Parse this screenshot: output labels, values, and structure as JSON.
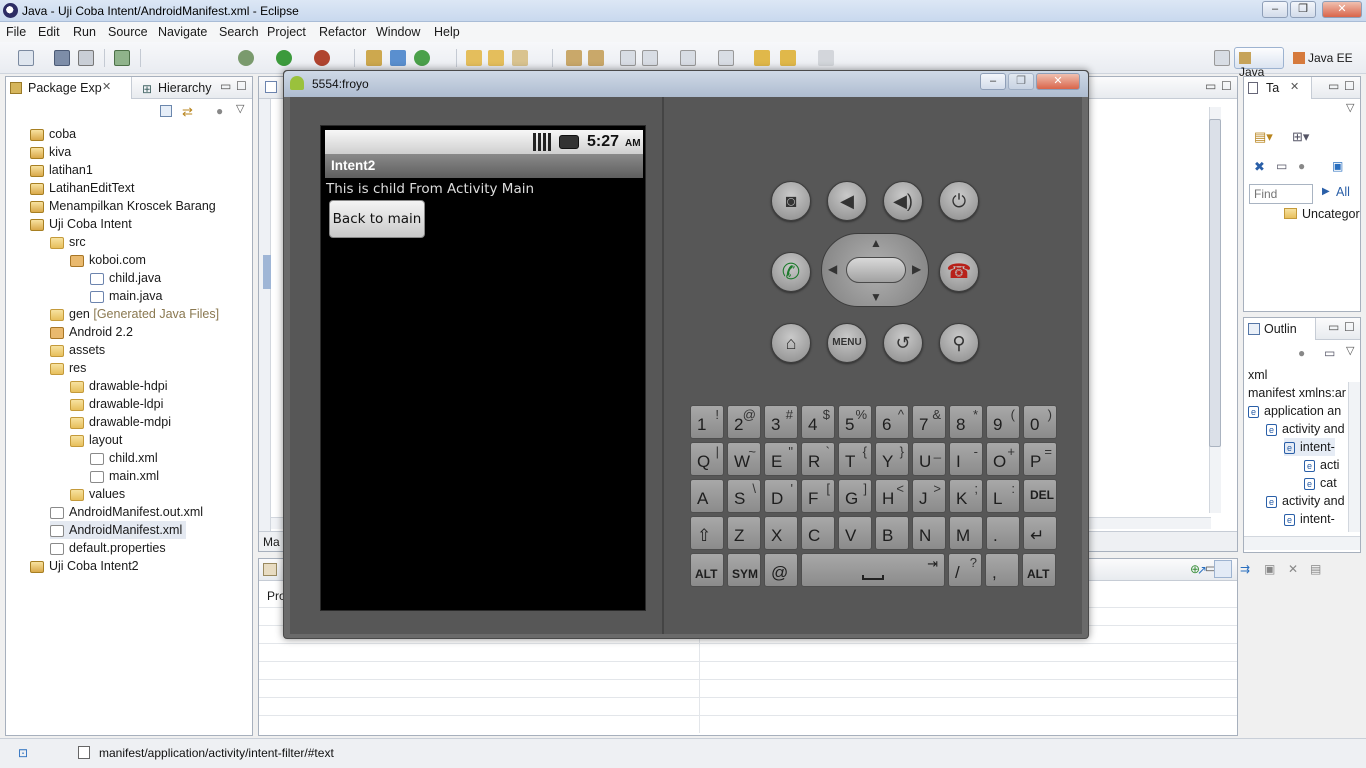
{
  "window": {
    "title": "Java - Uji Coba Intent/AndroidManifest.xml - Eclipse"
  },
  "menu": [
    "File",
    "Edit",
    "Run",
    "Source",
    "Navigate",
    "Search",
    "Project",
    "Refactor",
    "Window",
    "Help"
  ],
  "perspectives": {
    "java": "Java",
    "javaee": "Java EE"
  },
  "package_explorer": {
    "tabs": [
      "Package Exp",
      "Hierarchy"
    ],
    "items": [
      {
        "label": "coba",
        "icon": "project-icon"
      },
      {
        "label": "kiva",
        "icon": "project-icon"
      },
      {
        "label": "latihan1",
        "icon": "project-icon"
      },
      {
        "label": "LatihanEditText",
        "icon": "project-icon"
      },
      {
        "label": "Menampilkan Kroscek Barang",
        "icon": "project-icon"
      },
      {
        "label": "Uji Coba Intent",
        "icon": "project-icon"
      },
      {
        "label": "src",
        "icon": "folder-icon"
      },
      {
        "label": "koboi.com",
        "icon": "package-icon"
      },
      {
        "label": "child.java",
        "icon": "java-file-icon"
      },
      {
        "label": "main.java",
        "icon": "java-file-icon"
      },
      {
        "label": "gen",
        "suffix": "[Generated Java Files]",
        "icon": "folder-icon"
      },
      {
        "label": "Android 2.2",
        "icon": "library-icon"
      },
      {
        "label": "assets",
        "icon": "folder-icon"
      },
      {
        "label": "res",
        "icon": "folder-icon"
      },
      {
        "label": "drawable-hdpi",
        "icon": "folder-icon"
      },
      {
        "label": "drawable-ldpi",
        "icon": "folder-icon"
      },
      {
        "label": "drawable-mdpi",
        "icon": "folder-icon"
      },
      {
        "label": "layout",
        "icon": "folder-icon"
      },
      {
        "label": "child.xml",
        "icon": "xml-file-icon"
      },
      {
        "label": "main.xml",
        "icon": "xml-file-icon"
      },
      {
        "label": "values",
        "icon": "folder-icon"
      },
      {
        "label": "AndroidManifest.out.xml",
        "icon": "xml-file-icon"
      },
      {
        "label": "AndroidManifest.xml",
        "icon": "xml-file-icon"
      },
      {
        "label": "default.properties",
        "icon": "file-icon"
      },
      {
        "label": "Uji Coba Intent2",
        "icon": "project-icon"
      }
    ]
  },
  "editor": {
    "bottom_tab_fragment": "Ma",
    "problems_fragment": "Pro"
  },
  "task_view": {
    "tab": "Ta",
    "find_placeholder": "Find",
    "all_label": "All",
    "uncategorized": "Uncategor"
  },
  "outline": {
    "tab": "Outlin",
    "items": [
      "xml",
      "manifest xmlns:ar",
      "application an",
      "activity and",
      "intent-",
      "acti",
      "cat",
      "activity and",
      "intent-"
    ]
  },
  "emulator": {
    "title": "5554:froyo",
    "status_time": "5:27",
    "status_ampm": "AM",
    "app_title": "Intent2",
    "body_text": "This is child From Activity Main",
    "button_label": "Back to main",
    "menu_key": "MENU"
  },
  "keyboard": {
    "rows": [
      [
        [
          "1",
          "!"
        ],
        [
          "2",
          "@"
        ],
        [
          "3",
          "#"
        ],
        [
          "4",
          "$"
        ],
        [
          "5",
          "%"
        ],
        [
          "6",
          "^"
        ],
        [
          "7",
          "&"
        ],
        [
          "8",
          "*"
        ],
        [
          "9",
          "("
        ],
        [
          "0",
          ")"
        ]
      ],
      [
        [
          "Q",
          "|"
        ],
        [
          "W",
          "~"
        ],
        [
          "E",
          "\""
        ],
        [
          "R",
          "`"
        ],
        [
          "T",
          "{"
        ],
        [
          "Y",
          "}"
        ],
        [
          "U",
          "_"
        ],
        [
          "I",
          "-"
        ],
        [
          "O",
          "+"
        ],
        [
          "P",
          "="
        ]
      ],
      [
        [
          "A",
          ""
        ],
        [
          "S",
          "\\"
        ],
        [
          "D",
          "'"
        ],
        [
          "F",
          "["
        ],
        [
          "G",
          "]"
        ],
        [
          "H",
          "<"
        ],
        [
          "J",
          ">"
        ],
        [
          "K",
          ";"
        ],
        [
          "L",
          ":"
        ],
        [
          "DEL",
          ""
        ]
      ],
      [
        [
          "⇧",
          ""
        ],
        [
          "Z",
          ""
        ],
        [
          "X",
          ""
        ],
        [
          "C",
          ""
        ],
        [
          "V",
          ""
        ],
        [
          "B",
          ""
        ],
        [
          "N",
          ""
        ],
        [
          "M",
          ""
        ],
        [
          ".",
          ""
        ],
        [
          "↵",
          ""
        ]
      ],
      [
        [
          "ALT",
          ""
        ],
        [
          "SYM",
          ""
        ],
        [
          "@",
          ""
        ],
        [
          "",
          ""
        ],
        [
          "/",
          "?"
        ],
        [
          ",",
          ""
        ],
        [
          "ALT",
          ""
        ]
      ]
    ]
  },
  "statusbar": {
    "path": "manifest/application/activity/intent-filter/#text"
  }
}
